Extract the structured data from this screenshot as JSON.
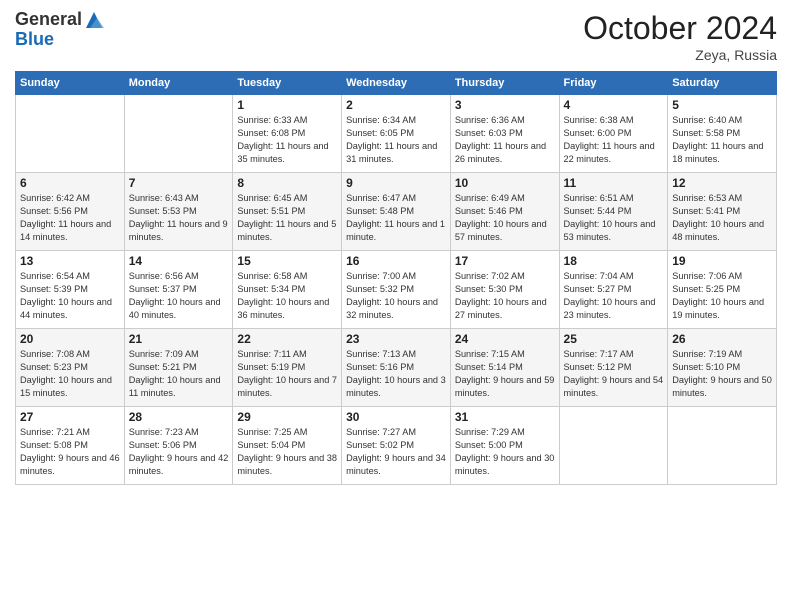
{
  "header": {
    "logo_line1": "General",
    "logo_line2": "Blue",
    "month_title": "October 2024",
    "location": "Zeya, Russia"
  },
  "days_of_week": [
    "Sunday",
    "Monday",
    "Tuesday",
    "Wednesday",
    "Thursday",
    "Friday",
    "Saturday"
  ],
  "weeks": [
    [
      {
        "day": "",
        "info": ""
      },
      {
        "day": "",
        "info": ""
      },
      {
        "day": "1",
        "info": "Sunrise: 6:33 AM\nSunset: 6:08 PM\nDaylight: 11 hours and 35 minutes."
      },
      {
        "day": "2",
        "info": "Sunrise: 6:34 AM\nSunset: 6:05 PM\nDaylight: 11 hours and 31 minutes."
      },
      {
        "day": "3",
        "info": "Sunrise: 6:36 AM\nSunset: 6:03 PM\nDaylight: 11 hours and 26 minutes."
      },
      {
        "day": "4",
        "info": "Sunrise: 6:38 AM\nSunset: 6:00 PM\nDaylight: 11 hours and 22 minutes."
      },
      {
        "day": "5",
        "info": "Sunrise: 6:40 AM\nSunset: 5:58 PM\nDaylight: 11 hours and 18 minutes."
      }
    ],
    [
      {
        "day": "6",
        "info": "Sunrise: 6:42 AM\nSunset: 5:56 PM\nDaylight: 11 hours and 14 minutes."
      },
      {
        "day": "7",
        "info": "Sunrise: 6:43 AM\nSunset: 5:53 PM\nDaylight: 11 hours and 9 minutes."
      },
      {
        "day": "8",
        "info": "Sunrise: 6:45 AM\nSunset: 5:51 PM\nDaylight: 11 hours and 5 minutes."
      },
      {
        "day": "9",
        "info": "Sunrise: 6:47 AM\nSunset: 5:48 PM\nDaylight: 11 hours and 1 minute."
      },
      {
        "day": "10",
        "info": "Sunrise: 6:49 AM\nSunset: 5:46 PM\nDaylight: 10 hours and 57 minutes."
      },
      {
        "day": "11",
        "info": "Sunrise: 6:51 AM\nSunset: 5:44 PM\nDaylight: 10 hours and 53 minutes."
      },
      {
        "day": "12",
        "info": "Sunrise: 6:53 AM\nSunset: 5:41 PM\nDaylight: 10 hours and 48 minutes."
      }
    ],
    [
      {
        "day": "13",
        "info": "Sunrise: 6:54 AM\nSunset: 5:39 PM\nDaylight: 10 hours and 44 minutes."
      },
      {
        "day": "14",
        "info": "Sunrise: 6:56 AM\nSunset: 5:37 PM\nDaylight: 10 hours and 40 minutes."
      },
      {
        "day": "15",
        "info": "Sunrise: 6:58 AM\nSunset: 5:34 PM\nDaylight: 10 hours and 36 minutes."
      },
      {
        "day": "16",
        "info": "Sunrise: 7:00 AM\nSunset: 5:32 PM\nDaylight: 10 hours and 32 minutes."
      },
      {
        "day": "17",
        "info": "Sunrise: 7:02 AM\nSunset: 5:30 PM\nDaylight: 10 hours and 27 minutes."
      },
      {
        "day": "18",
        "info": "Sunrise: 7:04 AM\nSunset: 5:27 PM\nDaylight: 10 hours and 23 minutes."
      },
      {
        "day": "19",
        "info": "Sunrise: 7:06 AM\nSunset: 5:25 PM\nDaylight: 10 hours and 19 minutes."
      }
    ],
    [
      {
        "day": "20",
        "info": "Sunrise: 7:08 AM\nSunset: 5:23 PM\nDaylight: 10 hours and 15 minutes."
      },
      {
        "day": "21",
        "info": "Sunrise: 7:09 AM\nSunset: 5:21 PM\nDaylight: 10 hours and 11 minutes."
      },
      {
        "day": "22",
        "info": "Sunrise: 7:11 AM\nSunset: 5:19 PM\nDaylight: 10 hours and 7 minutes."
      },
      {
        "day": "23",
        "info": "Sunrise: 7:13 AM\nSunset: 5:16 PM\nDaylight: 10 hours and 3 minutes."
      },
      {
        "day": "24",
        "info": "Sunrise: 7:15 AM\nSunset: 5:14 PM\nDaylight: 9 hours and 59 minutes."
      },
      {
        "day": "25",
        "info": "Sunrise: 7:17 AM\nSunset: 5:12 PM\nDaylight: 9 hours and 54 minutes."
      },
      {
        "day": "26",
        "info": "Sunrise: 7:19 AM\nSunset: 5:10 PM\nDaylight: 9 hours and 50 minutes."
      }
    ],
    [
      {
        "day": "27",
        "info": "Sunrise: 7:21 AM\nSunset: 5:08 PM\nDaylight: 9 hours and 46 minutes."
      },
      {
        "day": "28",
        "info": "Sunrise: 7:23 AM\nSunset: 5:06 PM\nDaylight: 9 hours and 42 minutes."
      },
      {
        "day": "29",
        "info": "Sunrise: 7:25 AM\nSunset: 5:04 PM\nDaylight: 9 hours and 38 minutes."
      },
      {
        "day": "30",
        "info": "Sunrise: 7:27 AM\nSunset: 5:02 PM\nDaylight: 9 hours and 34 minutes."
      },
      {
        "day": "31",
        "info": "Sunrise: 7:29 AM\nSunset: 5:00 PM\nDaylight: 9 hours and 30 minutes."
      },
      {
        "day": "",
        "info": ""
      },
      {
        "day": "",
        "info": ""
      }
    ]
  ]
}
